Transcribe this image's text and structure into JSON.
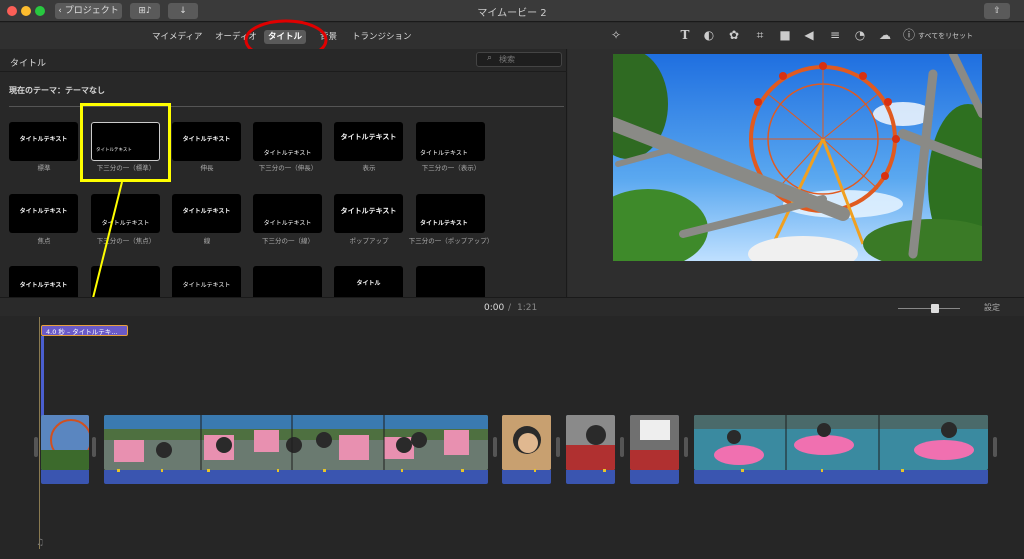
{
  "window": {
    "title": "マイムービー 2",
    "back_label": "プロジェクト",
    "clipfilter_label": "⊞♪",
    "import_label": "↓",
    "share_label": "⇧"
  },
  "tabs": [
    {
      "label": "マイメディア",
      "selected": false
    },
    {
      "label": "オーディオ",
      "selected": false
    },
    {
      "label": "タイトル",
      "selected": true
    },
    {
      "label": "背景",
      "selected": false
    },
    {
      "label": "トランジション",
      "selected": false
    }
  ],
  "browser": {
    "header": "タイトル",
    "search_placeholder": "検索",
    "theme": "現在のテーマ：テーマなし"
  },
  "titles": [
    {
      "text": "タイトルテキスト",
      "caption": "標準"
    },
    {
      "text": "タイトルテキスト",
      "caption": "下三分の一（標準）"
    },
    {
      "text": "タイトルテキスト",
      "caption": "伸長"
    },
    {
      "text": "タイトルテキスト",
      "caption": "下三分の一（伸長）"
    },
    {
      "text": "タイトルテキスト",
      "caption": "表示"
    },
    {
      "text": "タイトルテキスト",
      "caption": "下三分の一（表示）"
    },
    {
      "text": "タイトルテキスト",
      "caption": "焦点"
    },
    {
      "text": "タイトルテキスト",
      "caption": "下三分の一（焦点）"
    },
    {
      "text": "タイトルテキスト",
      "caption": "線"
    },
    {
      "text": "タイトルテキスト",
      "caption": "下三分の一（線）"
    },
    {
      "text": "タイトルテキスト",
      "caption": "ポップアップ"
    },
    {
      "text": "タイトルテキスト",
      "caption": "下三分の一（ポップアップ）"
    },
    {
      "text": "タイトルテキスト",
      "caption": ""
    },
    {
      "text": "",
      "caption": ""
    },
    {
      "text": "タイトルテキスト",
      "caption": ""
    },
    {
      "text": "",
      "caption": ""
    },
    {
      "text": "タイトル",
      "caption": ""
    },
    {
      "text": "",
      "caption": ""
    }
  ],
  "viewer": {
    "reset_label": "すべてをリセット"
  },
  "timeline": {
    "time_current": "0:00",
    "time_sep": "/",
    "time_total": "1:21",
    "settings_label": "設定",
    "title_clip_label": "4.0 秒 – タイトルテキ…",
    "zoom": 0.6
  },
  "colors": {
    "accent_blue": "#4a5fd0",
    "title_clip": "#6a5ac8",
    "highlight_yellow": "#ffff00",
    "annotation_red": "#e00000",
    "audio_blue": "#3a55b0",
    "wave": "#e6c42a"
  }
}
